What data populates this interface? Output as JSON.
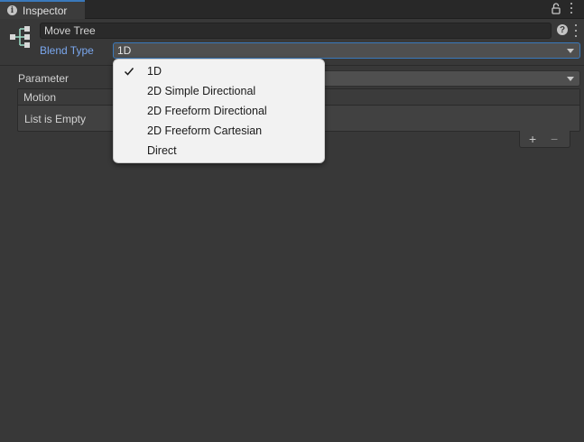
{
  "tab": {
    "title": "Inspector",
    "info_icon": "info-icon",
    "lock_icon": "lock-icon",
    "menu_icon": "kebab-menu-icon"
  },
  "header": {
    "name": "Move Tree",
    "help_glyph": "?",
    "icon": "blend-tree-icon"
  },
  "blend_type": {
    "label": "Blend Type",
    "value": "1D"
  },
  "parameter": {
    "label": "Parameter",
    "value": ""
  },
  "motion_list": {
    "header": "Motion",
    "empty_text": "List is Empty",
    "add_label": "+",
    "remove_label": "−"
  },
  "dropdown": {
    "items": [
      {
        "label": "1D",
        "checked": true
      },
      {
        "label": "2D Simple Directional",
        "checked": false
      },
      {
        "label": "2D Freeform Directional",
        "checked": false
      },
      {
        "label": "2D Freeform Cartesian",
        "checked": false
      },
      {
        "label": "Direct",
        "checked": false
      }
    ]
  },
  "colors": {
    "background": "#383838",
    "accent": "#3a79bb",
    "label_highlight": "#7aa7ee",
    "dropdown_bg": "#f2f2f2"
  }
}
